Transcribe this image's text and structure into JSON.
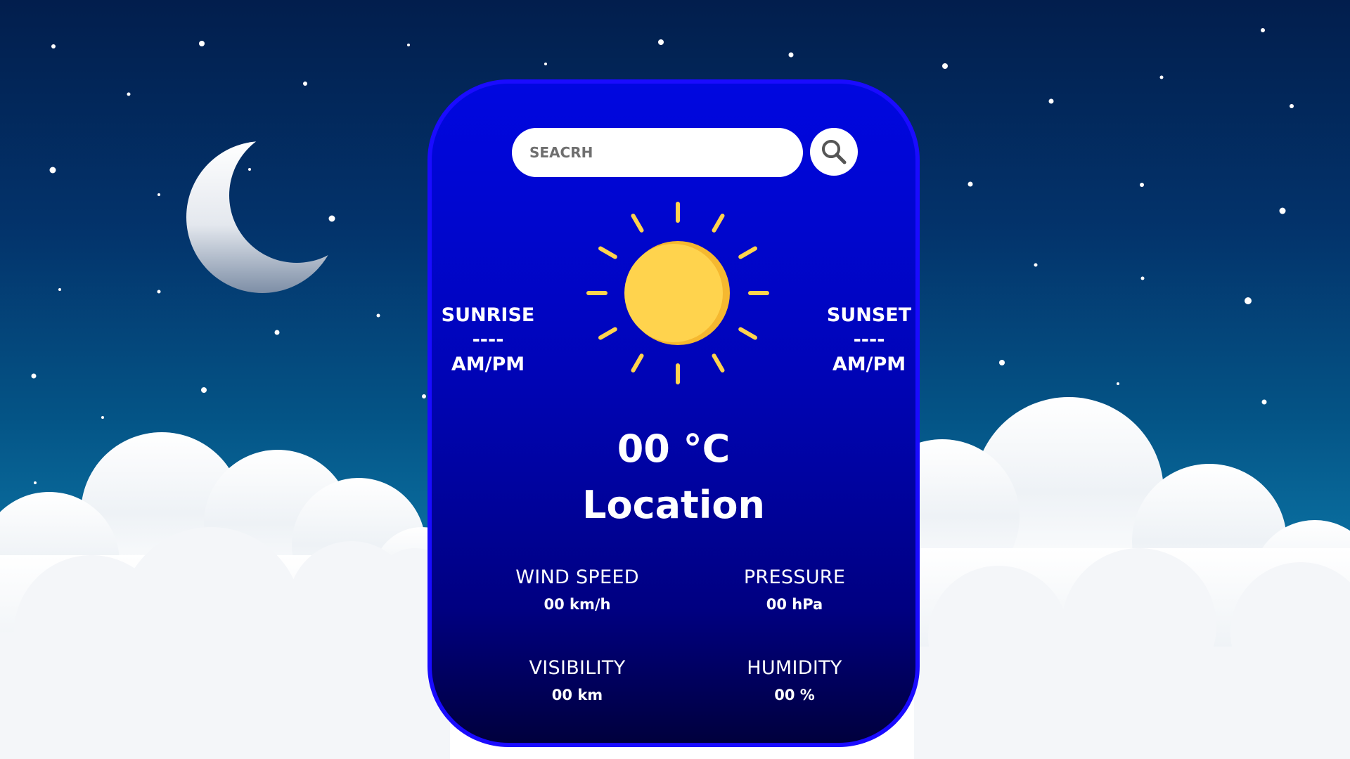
{
  "search": {
    "placeholder": "SEACRH",
    "value": ""
  },
  "icons": {
    "search": "search-icon",
    "sun": "sun-icon",
    "moon": "crescent-moon-icon"
  },
  "colors": {
    "card_top": "#0007e0",
    "card_bottom": "#00003d",
    "card_border": "#1a0bff",
    "sun": "#ffd34d",
    "sun_shade": "#f5b830",
    "sky_top": "#021e4d"
  },
  "sunrise": {
    "label": "SUNRISE",
    "time": "----",
    "period": "AM/PM"
  },
  "sunset": {
    "label": "SUNSET",
    "time": "----",
    "period": "AM/PM"
  },
  "weather": {
    "temperature": "00 °C",
    "location": "Location"
  },
  "stats": {
    "wind_speed": {
      "label": "WIND SPEED",
      "value": "00 km/h"
    },
    "pressure": {
      "label": "PRESSURE",
      "value": "00 hPa"
    },
    "visibility": {
      "label": "VISIBILITY",
      "value": "00 km"
    },
    "humidity": {
      "label": "HUMIDITY",
      "value": "00 %"
    }
  }
}
